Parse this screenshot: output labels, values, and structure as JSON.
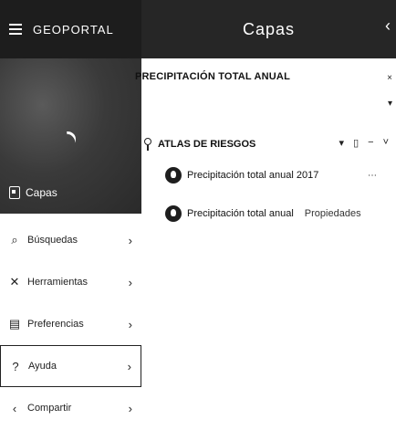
{
  "app": {
    "title": "GEOPORTAL"
  },
  "banner": {
    "label": "Capas"
  },
  "menu": [
    {
      "label": "Búsquedas",
      "icon": "search-icon"
    },
    {
      "label": "Herramientas",
      "icon": "tools-icon"
    },
    {
      "label": "Preferencias",
      "icon": "clipboard-icon"
    },
    {
      "label": "Ayuda",
      "icon": "help-icon"
    },
    {
      "label": "Compartir",
      "icon": "share-icon"
    }
  ],
  "panel": {
    "title": "Capas",
    "section": "PRECIPITACIÓN TOTAL ANUAL",
    "group": "ATLAS DE RIESGOS",
    "layers": [
      {
        "label": "Precipitación total anual 2017",
        "extra": ""
      },
      {
        "label": "Precipitación total anual",
        "extra": "Propiedades"
      }
    ]
  }
}
